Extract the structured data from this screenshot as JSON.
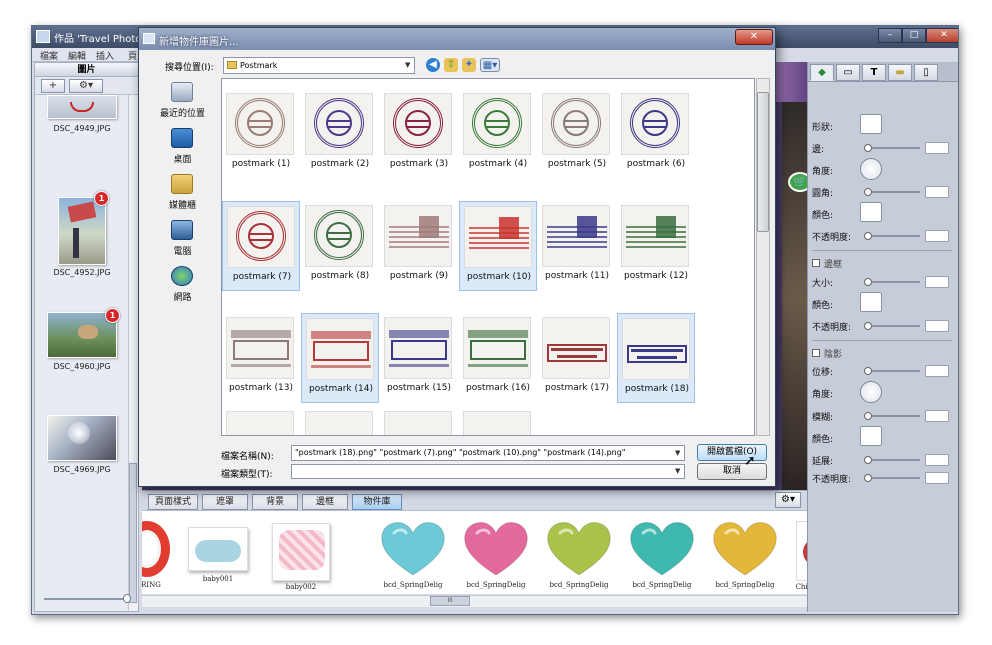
{
  "app": {
    "title": "作品 'Travel Photos'",
    "menu": [
      "檔案",
      "編輯",
      "插入",
      "頁"
    ],
    "window_controls": [
      "–",
      "□",
      "✕"
    ]
  },
  "left_panel": {
    "header": "圖片",
    "add_label": "+",
    "settings_label": "⚙▾",
    "photos": [
      {
        "name": "DSC_4949.JPG",
        "badge": ""
      },
      {
        "name": "DSC_4952.JPG",
        "badge": "1"
      },
      {
        "name": "DSC_4960.JPG",
        "badge": "1"
      },
      {
        "name": "DSC_4969.JPG",
        "badge": ""
      }
    ]
  },
  "bottom_tabs": {
    "tabs": [
      "頁面樣式",
      "遮罩",
      "背景",
      "邊框",
      "物件庫"
    ],
    "active_index": 4,
    "gear_label": "⚙▾"
  },
  "object_strip": {
    "items": [
      {
        "label": "RING"
      },
      {
        "label": "baby001"
      },
      {
        "label": "baby002"
      },
      {
        "label": "bcd_SpringDelig",
        "color": "#6cc9d6"
      },
      {
        "label": "bcd_SpringDelig",
        "color": "#e46a9e"
      },
      {
        "label": "bcd_SpringDelig",
        "color": "#a9c24a"
      },
      {
        "label": "bcd_SpringDelig",
        "color": "#3fb9b0"
      },
      {
        "label": "bcd_SpringDelig",
        "color": "#e3b83a"
      },
      {
        "label": "Chinese we"
      }
    ],
    "scroll_label": "III"
  },
  "right_panel": {
    "tabs": [
      "◆",
      "▭",
      "T",
      "▬",
      "▯"
    ],
    "props": [
      {
        "label": "形狀:"
      },
      {
        "label": "邊:"
      },
      {
        "label": "角度:"
      },
      {
        "label": "圓角:"
      },
      {
        "label": "顏色:"
      },
      {
        "label": "不透明度:"
      }
    ],
    "border_section": "邊框",
    "border_props": [
      {
        "label": "大小:"
      },
      {
        "label": "顏色:"
      },
      {
        "label": "不透明度:"
      }
    ],
    "shadow_section": "陰影",
    "shadow_props": [
      {
        "label": "位移:"
      },
      {
        "label": "角度:"
      },
      {
        "label": "模糊:"
      },
      {
        "label": "顏色:"
      },
      {
        "label": "延展:"
      },
      {
        "label": "不透明度:"
      }
    ]
  },
  "dialog": {
    "title": "新增物件庫圖片...",
    "close_label": "✕",
    "look_in_label": "搜尋位置(I):",
    "look_in_value": "Postmark",
    "places": [
      "最近的位置",
      "桌面",
      "媒體櫃",
      "電腦",
      "網路"
    ],
    "files": [
      {
        "name": "postmark (1)",
        "color": "#9a7b73",
        "kind": "circle",
        "selected": false
      },
      {
        "name": "postmark (2)",
        "color": "#4b3a8a",
        "kind": "circle",
        "selected": false
      },
      {
        "name": "postmark (3)",
        "color": "#8a2246",
        "kind": "circle",
        "selected": false
      },
      {
        "name": "postmark (4)",
        "color": "#3a7a3e",
        "kind": "circle",
        "selected": false
      },
      {
        "name": "postmark (5)",
        "color": "#8a7a78",
        "kind": "circle",
        "selected": false
      },
      {
        "name": "postmark (6)",
        "color": "#3b3a8a",
        "kind": "circle",
        "selected": false
      },
      {
        "name": "postmark (7)",
        "color": "#a8323a",
        "kind": "circle",
        "selected": true
      },
      {
        "name": "postmark (8)",
        "color": "#3f6e44",
        "kind": "circle",
        "selected": false
      },
      {
        "name": "postmark (9)",
        "color": "#a07a7a",
        "kind": "wave",
        "selected": false
      },
      {
        "name": "postmark (10)",
        "color": "#c8342e",
        "kind": "wave",
        "selected": true
      },
      {
        "name": "postmark (11)",
        "color": "#3a3a8a",
        "kind": "wave",
        "selected": false
      },
      {
        "name": "postmark (12)",
        "color": "#3a6e3e",
        "kind": "wave",
        "selected": false
      },
      {
        "name": "postmark (13)",
        "color": "#8a7a78",
        "kind": "protect",
        "selected": false
      },
      {
        "name": "postmark (14)",
        "color": "#b8383a",
        "kind": "protect",
        "selected": true
      },
      {
        "name": "postmark (15)",
        "color": "#3b3a8a",
        "kind": "protect",
        "selected": false
      },
      {
        "name": "postmark (16)",
        "color": "#3a6e3e",
        "kind": "protect",
        "selected": false
      },
      {
        "name": "postmark (17)",
        "color": "#9a3a3a",
        "kind": "service",
        "selected": false
      },
      {
        "name": "postmark (18)",
        "color": "#3a3a8a",
        "kind": "service",
        "selected": true
      },
      {
        "name": "",
        "color": "#8a6a60",
        "kind": "travel",
        "selected": false
      },
      {
        "name": "",
        "color": "#3a3a8a",
        "kind": "travel",
        "selected": false
      },
      {
        "name": "",
        "color": "#b8383a",
        "kind": "travel",
        "selected": false
      },
      {
        "name": "",
        "color": "#3a6e3e",
        "kind": "travel",
        "selected": false
      }
    ],
    "filename_label": "檔案名稱(N):",
    "filename_value": "\"postmark (18).png\" \"postmark (7).png\" \"postmark (10).png\" \"postmark (14).png\"",
    "filetype_label": "檔案類型(T):",
    "filetype_value": "",
    "open_label": "開啟舊檔(O)",
    "cancel_label": "取消"
  }
}
